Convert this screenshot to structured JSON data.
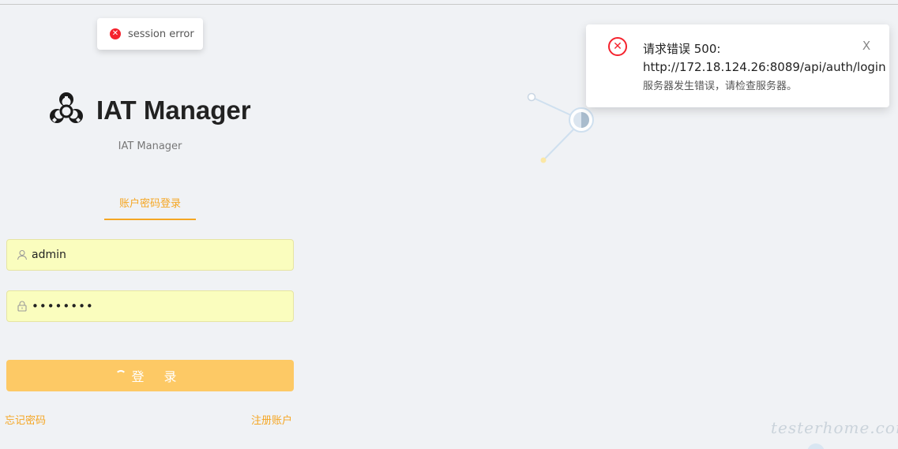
{
  "toast": {
    "icon": "close-circle-icon",
    "message": "session error"
  },
  "notification": {
    "icon": "close-circle-outline-icon",
    "title": "请求错误 500:",
    "url": "http://172.18.124.26:8089/api/auth/login",
    "description": "服务器发生错误，请检查服务器。",
    "close_label": "X"
  },
  "brand": {
    "logo_icon": "biohazard-icon",
    "name": "IAT Manager",
    "subtitle": "IAT Manager"
  },
  "login": {
    "tab_label": "账户密码登录",
    "username_icon": "user-icon",
    "username_value": "admin",
    "password_icon": "lock-icon",
    "password_value": "••••••••",
    "submit_label": "登 录",
    "forgot_link": "忘记密码",
    "register_link": "注册账户"
  },
  "watermark": "testerhome.com",
  "colors": {
    "accent": "#f5a623",
    "error": "#f5222d",
    "button": "#fdc965",
    "input_bg": "#fafdbe"
  }
}
